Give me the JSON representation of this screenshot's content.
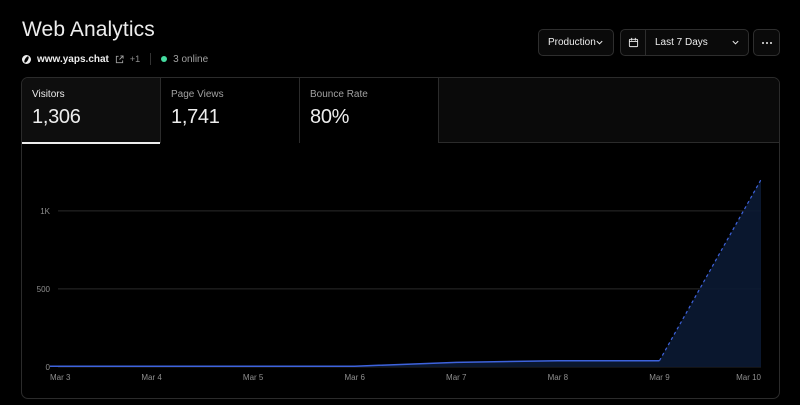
{
  "header": {
    "title": "Web Analytics",
    "domain": "www.yaps.chat",
    "extra_domains": "+1",
    "online": "3 online",
    "online_color": "#45dca0"
  },
  "controls": {
    "environment": "Production",
    "range": "Last 7 Days"
  },
  "tabs": [
    {
      "label": "Visitors",
      "value": "1,306",
      "active": true
    },
    {
      "label": "Page Views",
      "value": "1,741",
      "active": false
    },
    {
      "label": "Bounce Rate",
      "value": "80%",
      "active": false
    }
  ],
  "chart_data": {
    "type": "area",
    "title": "",
    "xlabel": "",
    "ylabel": "",
    "categories": [
      "Mar 3",
      "Mar 4",
      "Mar 5",
      "Mar 6",
      "Mar 7",
      "Mar 8",
      "Mar 9",
      "Mar 10"
    ],
    "values": [
      5,
      5,
      5,
      5,
      30,
      40,
      40,
      1200
    ],
    "projected_from_index": 6,
    "ylim": [
      0,
      1300
    ],
    "yticks": [
      0,
      500,
      1000
    ],
    "ytick_labels": [
      "0",
      "500",
      "1K"
    ],
    "grid": true,
    "line_color": "#3e63dd",
    "fill_color": "#0b1a33"
  }
}
